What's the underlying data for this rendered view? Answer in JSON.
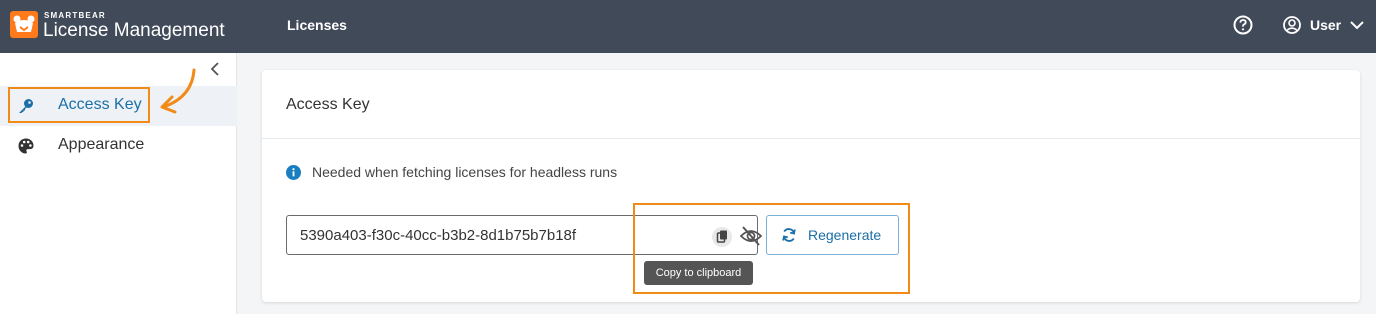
{
  "header": {
    "brand_small": "SMARTBEAR",
    "brand_title": "License Management",
    "nav_licenses": "Licenses",
    "user_label": "User"
  },
  "sidebar": {
    "items": [
      {
        "label": "Access Key",
        "icon": "key-icon",
        "active": true
      },
      {
        "label": "Appearance",
        "icon": "palette-icon",
        "active": false
      }
    ]
  },
  "card": {
    "title": "Access Key",
    "info_text": "Needed when fetching licenses for headless runs",
    "access_key_value": "5390a403-f30c-40cc-b3b2-8d1b75b7b18f",
    "regenerate_label": "Regenerate",
    "tooltip": "Copy to clipboard"
  },
  "colors": {
    "header_bg": "#414a58",
    "brand_accent": "#ff7a1a",
    "link_blue": "#1a6fa8",
    "annotation_orange": "#f28a17"
  }
}
